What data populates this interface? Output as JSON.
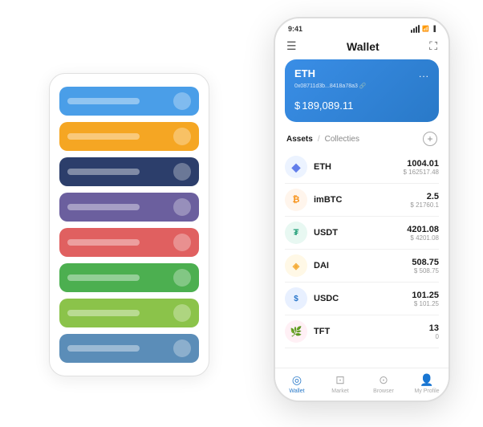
{
  "scene": {
    "card_stack": {
      "rows": [
        {
          "color": "row-blue",
          "label": ""
        },
        {
          "color": "row-yellow",
          "label": ""
        },
        {
          "color": "row-dark",
          "label": ""
        },
        {
          "color": "row-purple",
          "label": ""
        },
        {
          "color": "row-red",
          "label": ""
        },
        {
          "color": "row-green",
          "label": ""
        },
        {
          "color": "row-light-green",
          "label": ""
        },
        {
          "color": "row-steel-blue",
          "label": ""
        }
      ]
    },
    "phone": {
      "status": {
        "time": "9:41",
        "signal": "▌▌▌",
        "wifi": "WiFi",
        "battery": "🔋"
      },
      "header": {
        "menu_icon": "☰",
        "title": "Wallet",
        "expand_icon": "⛶"
      },
      "eth_card": {
        "name": "ETH",
        "address": "0x08711d3b...8418a78a3 🔗",
        "menu": "...",
        "balance_symbol": "$",
        "balance": "189,089.11"
      },
      "assets_tabs": {
        "active": "Assets",
        "separator": "/",
        "inactive": "Collecties"
      },
      "add_icon": "+",
      "assets": [
        {
          "symbol": "ETH",
          "icon_char": "◆",
          "icon_class": "eth-icon",
          "amount": "1004.01",
          "usd": "$ 162517.48"
        },
        {
          "symbol": "imBTC",
          "icon_char": "₿",
          "icon_class": "imbtc-icon",
          "amount": "2.5",
          "usd": "$ 21760.1"
        },
        {
          "symbol": "USDT",
          "icon_char": "₮",
          "icon_class": "usdt-icon",
          "amount": "4201.08",
          "usd": "$ 4201.08"
        },
        {
          "symbol": "DAI",
          "icon_char": "◈",
          "icon_class": "dai-icon",
          "amount": "508.75",
          "usd": "$ 508.75"
        },
        {
          "symbol": "USDC",
          "icon_char": "$",
          "icon_class": "usdc-icon",
          "amount": "101.25",
          "usd": "$ 101.25"
        },
        {
          "symbol": "TFT",
          "icon_char": "🌿",
          "icon_class": "tft-icon",
          "amount": "13",
          "usd": "0"
        }
      ],
      "tabs": [
        {
          "label": "Wallet",
          "icon": "◎",
          "active": true
        },
        {
          "label": "Market",
          "icon": "📊",
          "active": false
        },
        {
          "label": "Browser",
          "icon": "👤",
          "active": false
        },
        {
          "label": "My Profile",
          "icon": "👤",
          "active": false
        }
      ]
    }
  }
}
